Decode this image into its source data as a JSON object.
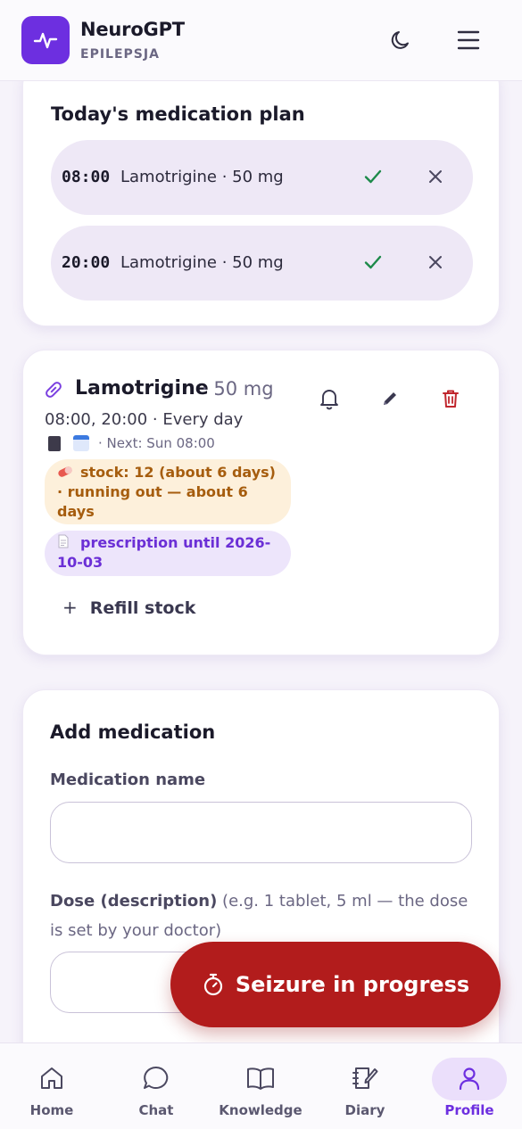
{
  "header": {
    "app_name": "NeuroGPT",
    "subtitle": "EPILEPSJA",
    "icons": [
      "pulse-logo-icon",
      "moon-icon",
      "menu-icon"
    ]
  },
  "plan": {
    "title": "Today's medication plan",
    "doses": [
      {
        "time": "08:00",
        "desc": "Lamotrigine · 50 mg"
      },
      {
        "time": "20:00",
        "desc": "Lamotrigine · 50 mg"
      }
    ]
  },
  "medication": {
    "name": "Lamotrigine",
    "dose": "· 50 mg",
    "schedule": "08:00, 20:00 · Every day",
    "next": "· Next: Sun 08:00",
    "stock": "stock: 12 (about 6 days) · running out — about 6 days",
    "prescription": "prescription until 2026-10-03",
    "refill_label": "Refill stock"
  },
  "add": {
    "title": "Add medication",
    "name_label": "Medication name",
    "name_value": "",
    "dose_label": "Dose (description)",
    "dose_hint": "(e.g. 1 tablet, 5 ml — the dose is set by your doctor)",
    "dose_value": ""
  },
  "seizure_button": "Seizure in progress",
  "nav": {
    "home": "Home",
    "chat": "Chat",
    "knowledge": "Knowledge",
    "diary": "Diary",
    "profile": "Profile",
    "active": "profile"
  },
  "colors": {
    "accent": "#6d2fe0",
    "danger": "#b21c1c",
    "success": "#1d8a4a",
    "warning_text": "#a65d0e"
  }
}
